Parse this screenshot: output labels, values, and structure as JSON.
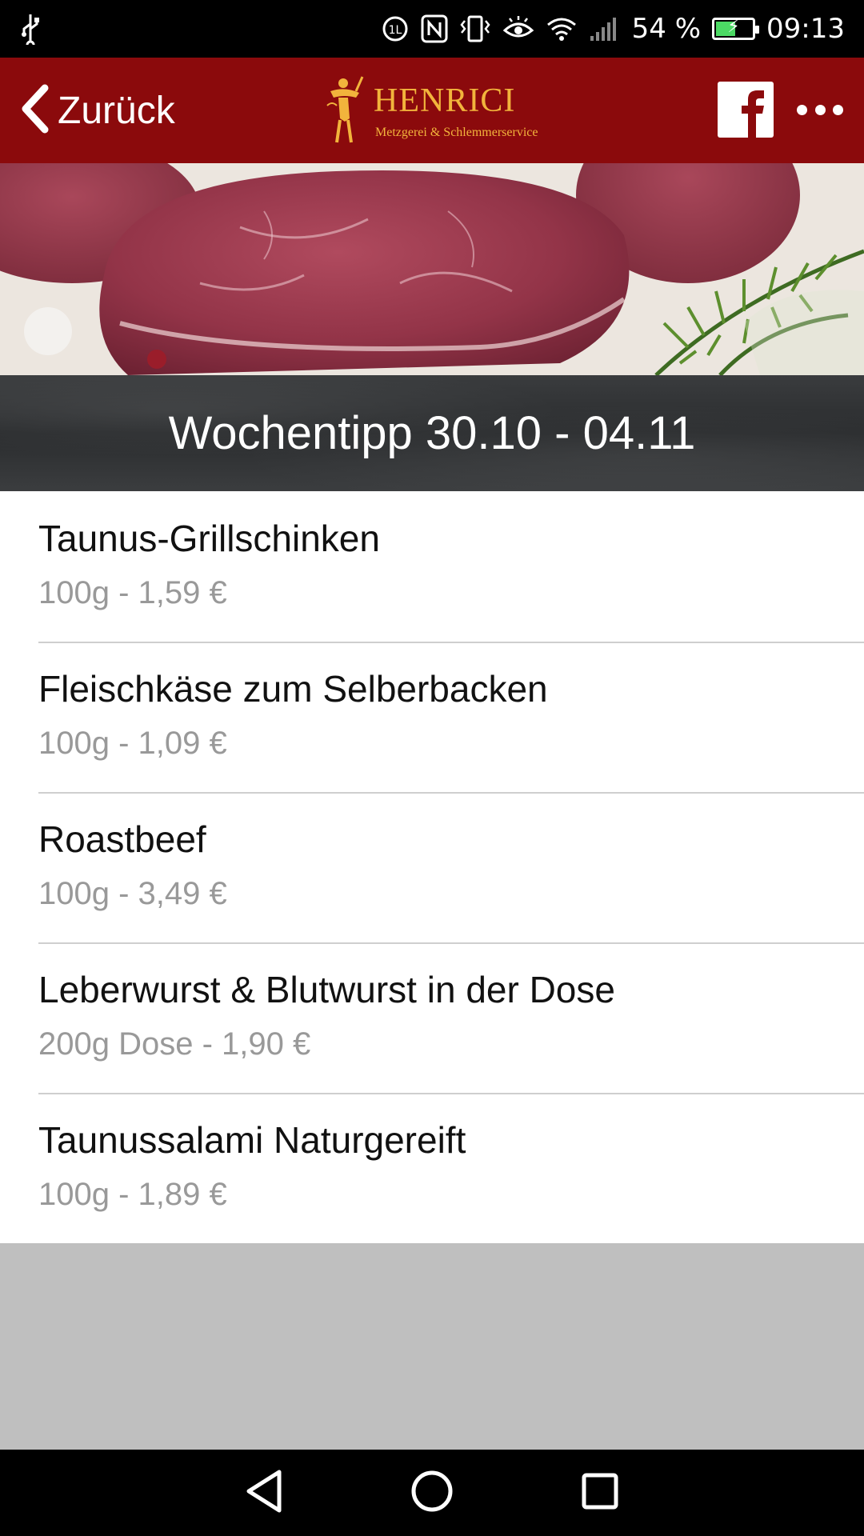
{
  "status_bar": {
    "battery_percent_label": "54 %",
    "battery_level": 0.54,
    "time": "09:13",
    "icons": [
      "usb-icon",
      "data-saver-icon",
      "nfc-icon",
      "vibrate-icon",
      "eye-comfort-icon",
      "wifi-icon",
      "signal-icon",
      "battery-icon"
    ]
  },
  "app_bar": {
    "back_label": "Zurück",
    "logo_name": "HENRICI",
    "logo_subtitle": "Metzgerei & Schlemmerservice",
    "icons": [
      "chevron-left-icon",
      "facebook-icon",
      "more-icon"
    ]
  },
  "banner": {
    "title": "Wochentipp 30.10 - 04.11"
  },
  "items": [
    {
      "title": "Taunus-Grillschinken",
      "price": "100g - 1,59 €"
    },
    {
      "title": "Fleischkäse zum Selberbacken",
      "price": "100g - 1,09 €"
    },
    {
      "title": "Roastbeef",
      "price": "100g - 3,49 €"
    },
    {
      "title": "Leberwurst & Blutwurst in der Dose",
      "price": "200g Dose - 1,90 €"
    },
    {
      "title": "Taunussalami Naturgereift",
      "price": "100g - 1,89 €"
    }
  ],
  "nav_bar": {
    "icons": [
      "back-triangle-icon",
      "home-circle-icon",
      "recents-square-icon"
    ]
  },
  "colors": {
    "app_bar": "#8b0a0c",
    "logo_gold": "#f2b43c",
    "price_gray": "#999999",
    "footer_gray": "#bfbfbf"
  }
}
